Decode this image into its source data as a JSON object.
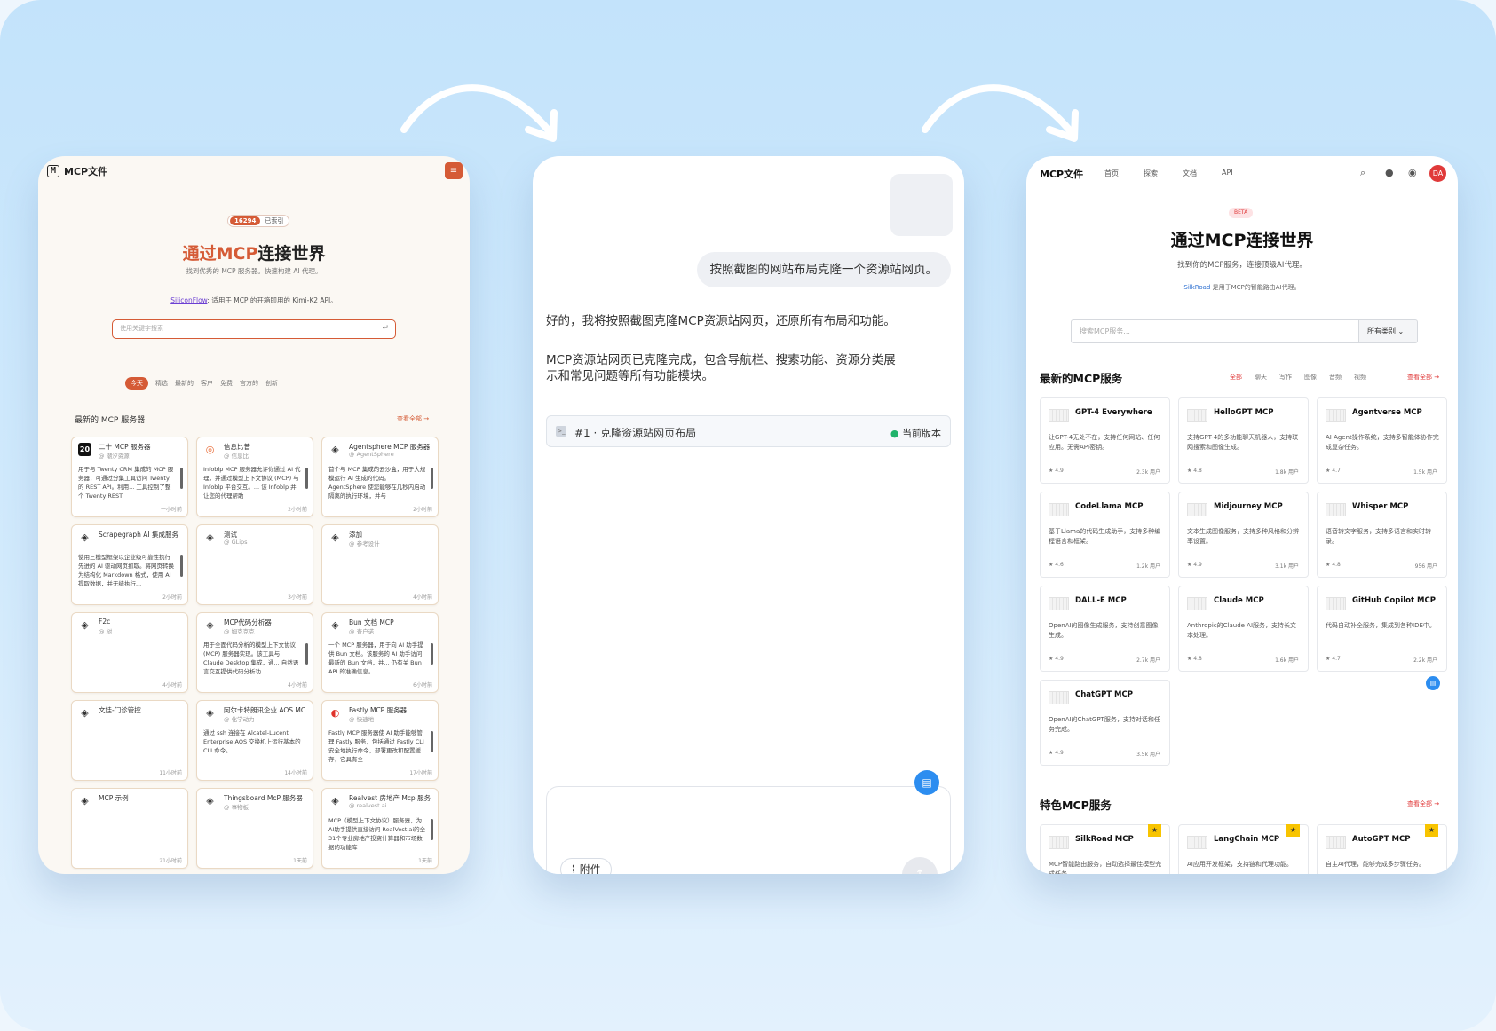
{
  "panel1": {
    "logo_letter": "M",
    "brand": "MCP文件",
    "menu_icon": "≡",
    "badge_count": "16294",
    "badge_text": "已索引",
    "title_accent": "通过MCP",
    "title_rest": "连接世界",
    "subtitle": "找到优秀的 MCP 服务器。快速构建 AI 代理。",
    "sponsor_link": "SiliconFlow",
    "sponsor_text": ": 适用于 MCP 的开箱即用的 Kimi-K2 API。",
    "search_placeholder": "使用关键字搜索",
    "enter_icon": "↵",
    "tabs": [
      "今天",
      "精选",
      "最新的",
      "客户",
      "免费",
      "官方的",
      "创新"
    ],
    "section_title": "最新的 MCP 服务器",
    "see_all": "查看全部 →",
    "cards": [
      {
        "icon": "20",
        "style": "blk",
        "name": "二十 MCP 服务器",
        "author": "@ 潮汐资源",
        "desc": "用于与 Twenty CRM 集成的 MCP 服务器，可通过分集工具访问 Twenty 的 REST API。利用... 工具控制了整个 Twenty REST",
        "time": "一小时前",
        "scroll": true
      },
      {
        "icon": "◎",
        "style": "org",
        "name": "信息比普",
        "author": "@ 信息比",
        "desc": "Infoblp MCP 服务器允许你通过 AI 代理，并通过模型上下文协议 (MCP) 与 Infoblp 平台交互。... 该 Infoblp 并让您的代理帮助",
        "time": "2小时前",
        "scroll": true
      },
      {
        "icon": "◈",
        "style": "",
        "name": "Agentsphere MCP 服务器",
        "author": "@ AgentSphere",
        "desc": "首个与 MCP 集成的云沙盒，用于大规模运行 AI 生成的代码。AgentSphere 使您能够在几秒内启动隔离的执行环境，并与",
        "time": "2小时前",
        "scroll": true
      },
      {
        "icon": "◈",
        "style": "",
        "name": "Scrapegraph AI 集成服务",
        "author": "",
        "desc": "使用三模型框架以企业级可靠性执行先进的 AI 驱动网页抓取。将网页转换为结构化 Markdown 格式，使用 AI 提取数据，并无缝执行...",
        "time": "2小时前",
        "scroll": true
      },
      {
        "icon": "◈",
        "style": "",
        "name": "测试",
        "author": "@ GLips",
        "desc": "",
        "time": "3小时前",
        "scroll": false
      },
      {
        "icon": "◈",
        "style": "",
        "name": "添加",
        "author": "@ 参考设计",
        "desc": "",
        "time": "4小时前",
        "scroll": false
      },
      {
        "icon": "◈",
        "style": "",
        "name": "F2c",
        "author": "@ 树",
        "desc": "",
        "time": "4小时前",
        "scroll": false
      },
      {
        "icon": "◈",
        "style": "",
        "name": "MCP代码分析器",
        "author": "@ 姆克克克",
        "desc": "用于全面代码分析的模型上下文协议 (MCP) 服务器实现。该工具与 Claude Desktop 集成，通... 自然语言交互提供代码分析功",
        "time": "4小时前",
        "scroll": true
      },
      {
        "icon": "◈",
        "style": "",
        "name": "Bun 文档 MCP",
        "author": "@ 查户诺",
        "desc": "一个 MCP 服务器，用于向 AI 助手提供 Bun 文档。该服务的 AI 助手访问最新的 Bun 文档，并... 仍有关 Bun API 的准确信息。",
        "time": "6小时前",
        "scroll": true
      },
      {
        "icon": "◈",
        "style": "",
        "name": "文娃-门诊管控",
        "author": "",
        "desc": "",
        "time": "11小时前",
        "scroll": false
      },
      {
        "icon": "◈",
        "style": "",
        "name": "阿尔卡特朗讯企业 AOS MC",
        "author": "@ 化学动力",
        "desc": "通过 ssh 连接在 Alcatel-Lucent Enterprise AOS 交换机上运行基本的 CLI 命令。",
        "time": "14小时前",
        "scroll": false
      },
      {
        "icon": "◐",
        "style": "red",
        "name": "Fastly MCP 服务器",
        "author": "@ 快速地",
        "desc": "Fastly MCP 服务器使 AI 助手能够管理 Fastly 服务，包括通过 Fastly CLI 安全地执行命令，部署更改和配置缓存，它具有全",
        "time": "17小时前",
        "scroll": true
      },
      {
        "icon": "◈",
        "style": "",
        "name": "MCP 示例",
        "author": "",
        "desc": "",
        "time": "21小时前",
        "scroll": false
      },
      {
        "icon": "◈",
        "style": "",
        "name": "Thingsboard McP 服务器",
        "author": "@ 事物板",
        "desc": "",
        "time": "1天前",
        "scroll": false
      },
      {
        "icon": "◈",
        "style": "",
        "name": "Realvest 房地产 Mcp 服务",
        "author": "@ realvest.ai",
        "desc": "MCP（模型上下文协议）服务器，为AI助手提供直接访问 RealVest.ai的全31个专业房地产投资计算器和市场数据的功能库",
        "time": "1天前",
        "scroll": true
      }
    ]
  },
  "panel2": {
    "user_message": "按照截图的网站布局克隆一个资源站网页。",
    "reply1": "好的，我将按照截图克隆MCP资源站网页，还原所有布局和功能。",
    "reply2_line1": "MCP资源站网页已克隆完成，包含导航栏、搜索功能、资源分类展",
    "reply2_line2": "示和常见问题等所有功能模块。",
    "version_title": "#1 · 克隆资源站网页布局",
    "version_dot": "●",
    "version_status": "当前版本",
    "attach_label": "附件",
    "send_icon": "↑"
  },
  "panel3": {
    "brand": "MCP文件",
    "nav": [
      "首页",
      "探索",
      "文档",
      "API"
    ],
    "avatar": "DA",
    "beta": "BETA",
    "title": "通过MCP连接世界",
    "subtitle": "找到你的MCP服务，连接顶级AI代理。",
    "sponsor_link": "SilkRoad",
    "sponsor_text": " 是用于MCP的智能路由AI代理。",
    "search_placeholder": "搜索MCP服务...",
    "category_select": "所有类别",
    "latest_title": "最新的MCP服务",
    "filters": [
      "全部",
      "聊天",
      "写作",
      "图像",
      "音频",
      "视频"
    ],
    "see_all": "查看全部 →",
    "featured_title": "特色MCP服务",
    "latest_cards": [
      {
        "name": "GPT-4 Everywhere",
        "desc": "让GPT-4无处不在，支持任何网站、任何应用。无需API密钥。",
        "rating": "★ 4.9",
        "users": "2.3k 用户"
      },
      {
        "name": "HelloGPT MCP",
        "desc": "支持GPT-4的多功能聊天机器人，支持联网搜索和图像生成。",
        "rating": "★ 4.8",
        "users": "1.8k 用户"
      },
      {
        "name": "Agentverse MCP",
        "desc": "AI Agent操作系统，支持多智能体协作完成复杂任务。",
        "rating": "★ 4.7",
        "users": "1.5k 用户"
      },
      {
        "name": "CodeLlama MCP",
        "desc": "基于Llama的代码生成助手，支持多种编程语言和框架。",
        "rating": "★ 4.6",
        "users": "1.2k 用户"
      },
      {
        "name": "Midjourney MCP",
        "desc": "文本生成图像服务，支持多种风格和分辨率设置。",
        "rating": "★ 4.9",
        "users": "3.1k 用户"
      },
      {
        "name": "Whisper MCP",
        "desc": "语音转文字服务，支持多语言和实时转录。",
        "rating": "★ 4.8",
        "users": "956 用户"
      },
      {
        "name": "DALL-E MCP",
        "desc": "OpenAI的图像生成服务，支持创意图像生成。",
        "rating": "★ 4.9",
        "users": "2.7k 用户"
      },
      {
        "name": "Claude MCP",
        "desc": "Anthropic的Claude AI服务，支持长文本处理。",
        "rating": "★ 4.8",
        "users": "1.6k 用户"
      },
      {
        "name": "GitHub Copilot MCP",
        "desc": "代码自动补全服务，集成到各种IDE中。",
        "rating": "★ 4.7",
        "users": "2.2k 用户"
      },
      {
        "name": "ChatGPT MCP",
        "desc": "OpenAI的ChatGPT服务，支持对话和任务完成。",
        "rating": "★ 4.9",
        "users": "3.5k 用户"
      }
    ],
    "featured_cards": [
      {
        "name": "SilkRoad MCP",
        "desc": "MCP智能路由服务，自动选择最佳模型完成任务。"
      },
      {
        "name": "LangChain MCP",
        "desc": "AI应用开发框架，支持链和代理功能。"
      },
      {
        "name": "AutoGPT MCP",
        "desc": "自主AI代理，能够完成多步骤任务。"
      }
    ]
  }
}
